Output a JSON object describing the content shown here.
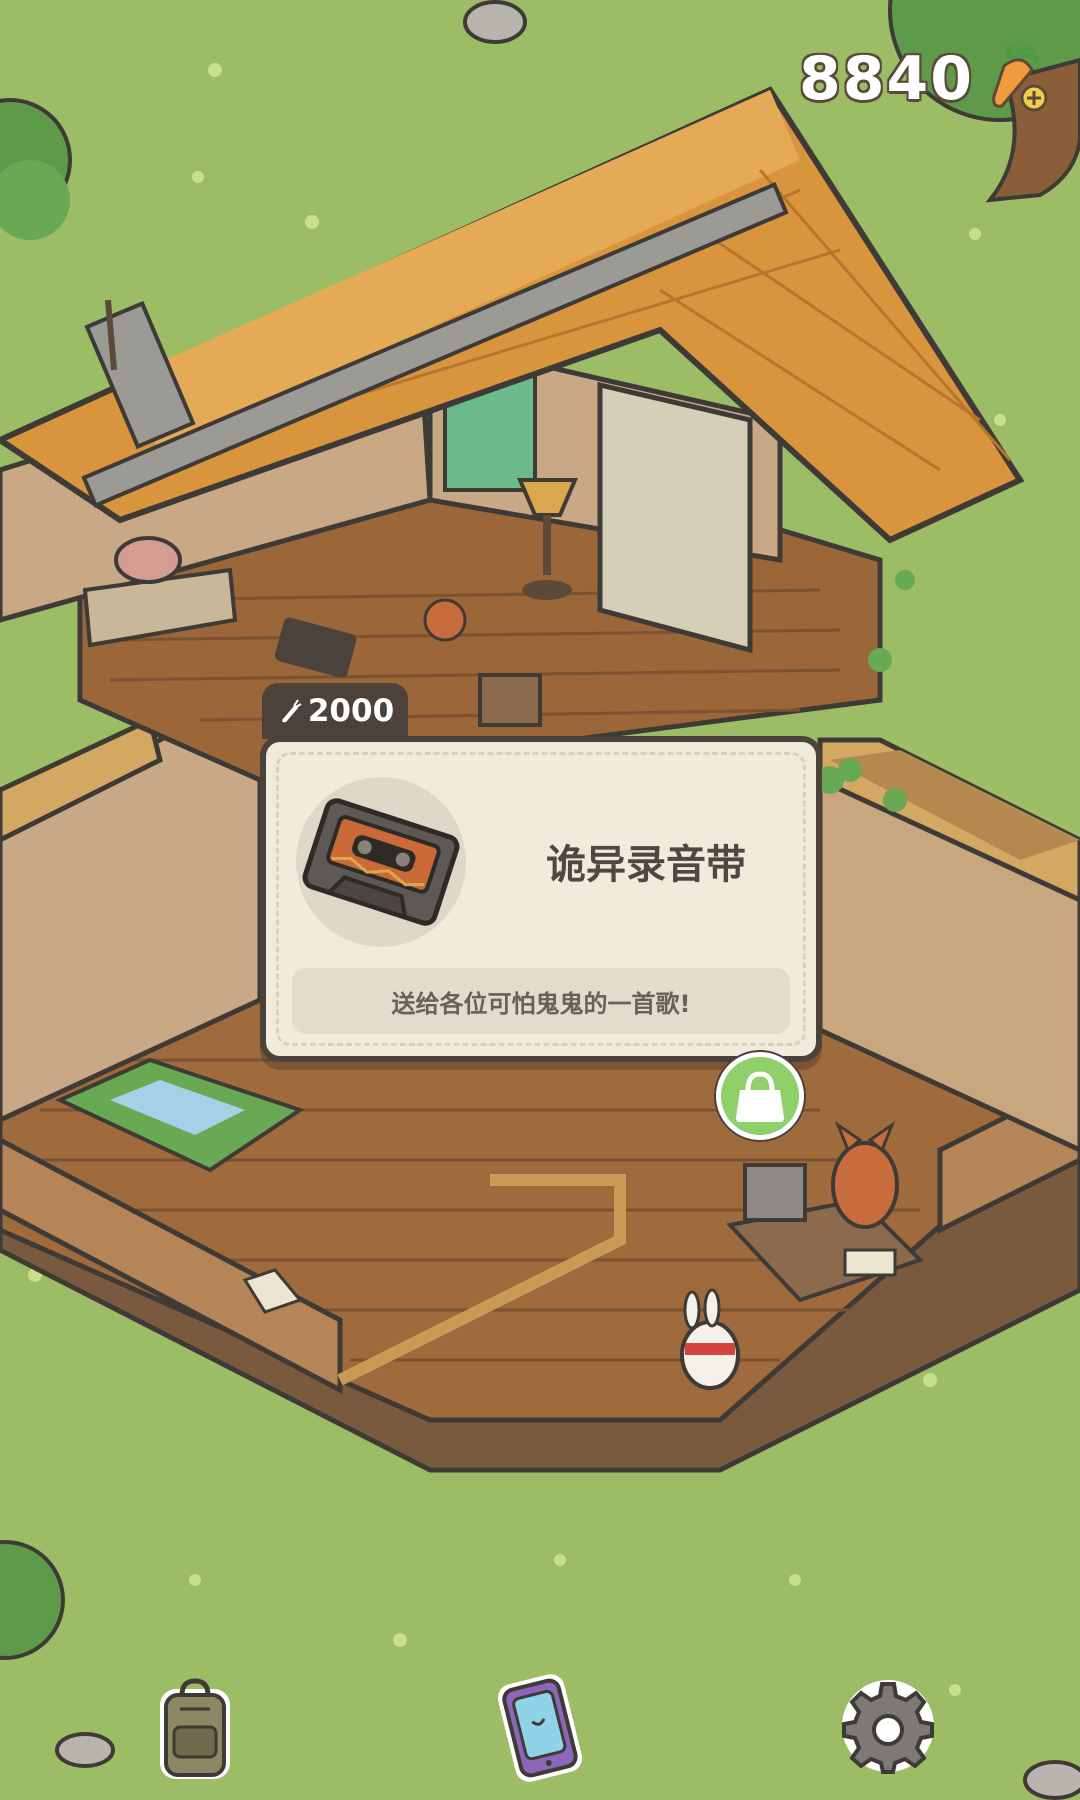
{
  "hud": {
    "currency_amount": "8840",
    "currency_icon": "carrot-plus-icon"
  },
  "item_card": {
    "price": "2000",
    "price_icon": "carrot-icon",
    "title": "诡异录音带",
    "description": "送给各位可怕鬼鬼的一首歌!",
    "item_icon": "cassette-tape-icon"
  },
  "actions": {
    "buy_icon": "shopping-bag-icon"
  },
  "bottom_bar": {
    "backpack_icon": "backpack-icon",
    "phone_icon": "phone-icon",
    "settings_icon": "gear-icon"
  },
  "colors": {
    "grass": "#9cbd66",
    "card_bg": "#f1ebdc",
    "card_border": "#4c423c",
    "buy_green": "#8fd06a",
    "floor": "#a06b3c",
    "roof": "#d9953d"
  }
}
